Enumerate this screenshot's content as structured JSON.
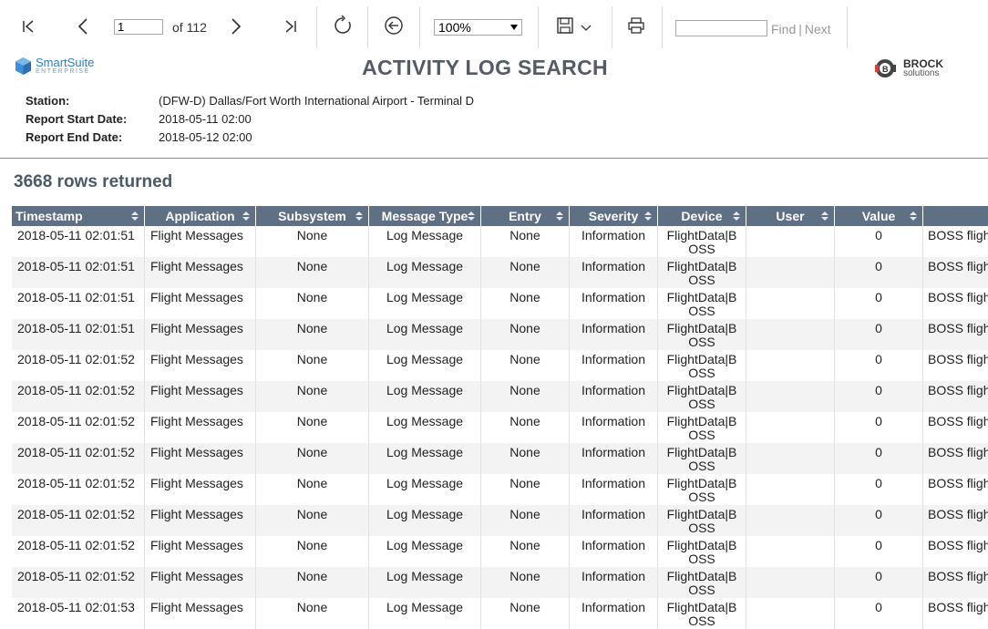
{
  "toolbar": {
    "page_value": "1",
    "page_of": "of 112",
    "zoom": "100%",
    "find_placeholder": "",
    "find_label": "Find",
    "next_label": "Next",
    "icons": [
      "first-page-icon",
      "prev-page-icon",
      "next-page-icon",
      "last-page-icon",
      "refresh-icon",
      "back-icon",
      "save-icon",
      "chevron-down-icon",
      "print-icon"
    ]
  },
  "header": {
    "left_logo_name": "SmartSuite",
    "left_logo_sub": "ENTERPRISE",
    "title": "ACTIVITY LOG SEARCH",
    "right_logo_name": "BROCK",
    "right_logo_sub": "solutions"
  },
  "info": [
    {
      "label": "Station:",
      "value": "(DFW-D) Dallas/Fort Worth International Airport - Terminal D"
    },
    {
      "label": "Report Start Date:",
      "value": "2018-05-11 02:00"
    },
    {
      "label": "Report End Date:",
      "value": "2018-05-12 02:00"
    }
  ],
  "rows_returned": "3668 rows returned",
  "columns": [
    "Timestamp",
    "Application",
    "Subsystem",
    "Message Type",
    "Entry",
    "Severity",
    "Device",
    "User",
    "Value",
    ""
  ],
  "rows": [
    [
      "2018-05-11 02:01:51",
      "Flight Messages",
      "None",
      "Log Message",
      "None",
      "Information",
      "FlightData|BOSS",
      "",
      "0",
      "BOSS flight"
    ],
    [
      "2018-05-11 02:01:51",
      "Flight Messages",
      "None",
      "Log Message",
      "None",
      "Information",
      "FlightData|BOSS",
      "",
      "0",
      "BOSS flight"
    ],
    [
      "2018-05-11 02:01:51",
      "Flight Messages",
      "None",
      "Log Message",
      "None",
      "Information",
      "FlightData|BOSS",
      "",
      "0",
      "BOSS flight"
    ],
    [
      "2018-05-11 02:01:51",
      "Flight Messages",
      "None",
      "Log Message",
      "None",
      "Information",
      "FlightData|BOSS",
      "",
      "0",
      "BOSS flight"
    ],
    [
      "2018-05-11 02:01:52",
      "Flight Messages",
      "None",
      "Log Message",
      "None",
      "Information",
      "FlightData|BOSS",
      "",
      "0",
      "BOSS flight"
    ],
    [
      "2018-05-11 02:01:52",
      "Flight Messages",
      "None",
      "Log Message",
      "None",
      "Information",
      "FlightData|BOSS",
      "",
      "0",
      "BOSS flight"
    ],
    [
      "2018-05-11 02:01:52",
      "Flight Messages",
      "None",
      "Log Message",
      "None",
      "Information",
      "FlightData|BOSS",
      "",
      "0",
      "BOSS flight"
    ],
    [
      "2018-05-11 02:01:52",
      "Flight Messages",
      "None",
      "Log Message",
      "None",
      "Information",
      "FlightData|BOSS",
      "",
      "0",
      "BOSS flight"
    ],
    [
      "2018-05-11 02:01:52",
      "Flight Messages",
      "None",
      "Log Message",
      "None",
      "Information",
      "FlightData|BOSS",
      "",
      "0",
      "BOSS flight"
    ],
    [
      "2018-05-11 02:01:52",
      "Flight Messages",
      "None",
      "Log Message",
      "None",
      "Information",
      "FlightData|BOSS",
      "",
      "0",
      "BOSS flight"
    ],
    [
      "2018-05-11 02:01:52",
      "Flight Messages",
      "None",
      "Log Message",
      "None",
      "Information",
      "FlightData|BOSS",
      "",
      "0",
      "BOSS flight"
    ],
    [
      "2018-05-11 02:01:52",
      "Flight Messages",
      "None",
      "Log Message",
      "None",
      "Information",
      "FlightData|BOSS",
      "",
      "0",
      "BOSS flight"
    ],
    [
      "2018-05-11 02:01:53",
      "Flight Messages",
      "None",
      "Log Message",
      "None",
      "Information",
      "FlightData|BOSS",
      "",
      "0",
      "BOSS flight"
    ]
  ],
  "colors": {
    "header_bg": "#5f6f84",
    "title": "#555b66",
    "rowcount": "#4b5968",
    "stripe": "#f3f3f3"
  }
}
